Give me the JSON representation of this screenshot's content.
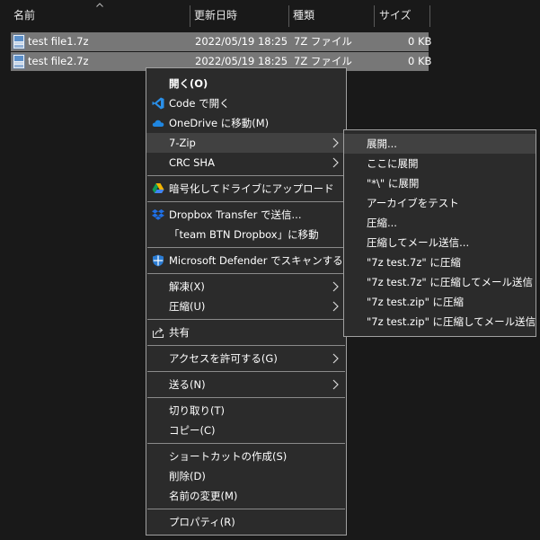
{
  "columns": {
    "name": "名前",
    "modified": "更新日時",
    "type": "種類",
    "size": "サイズ"
  },
  "files": [
    {
      "name": "test file1.7z",
      "modified": "2022/05/19 18:25",
      "type": "7Z ファイル",
      "size": "0 KB"
    },
    {
      "name": "test file2.7z",
      "modified": "2022/05/19 18:25",
      "type": "7Z ファイル",
      "size": "0 KB"
    }
  ],
  "context_menu": {
    "open": "開く(O)",
    "code": "Code で開く",
    "onedrive": "OneDrive に移動(M)",
    "zip7": "7-Zip",
    "crc": "CRC SHA",
    "encrypt": "暗号化してドライブにアップロード",
    "dropbox_transfer": "Dropbox Transfer で送信...",
    "dropbox_move": "「team BTN Dropbox」に移動",
    "defender": "Microsoft Defender でスキャンする...",
    "extract": "解凍(X)",
    "compress": "圧縮(U)",
    "share": "共有",
    "access": "アクセスを許可する(G)",
    "send": "送る(N)",
    "cut": "切り取り(T)",
    "copy": "コピー(C)",
    "shortcut": "ショートカットの作成(S)",
    "delete": "削除(D)",
    "rename": "名前の変更(M)",
    "properties": "プロパティ(R)"
  },
  "submenu_7zip": [
    "展開...",
    "ここに展開",
    "\"*\\\" に展開",
    "アーカイブをテスト",
    "圧縮...",
    "圧縮してメール送信...",
    "\"7z test.7z\" に圧縮",
    "\"7z test.7z\" に圧縮してメール送信",
    "\"7z test.zip\" に圧縮",
    "\"7z test.zip\" に圧縮してメール送信"
  ],
  "colors": {
    "background": "#191919",
    "selected_row": "#777777",
    "menu_bg": "#2b2b2b",
    "menu_highlight": "#414141",
    "vscode_blue": "#2a8fe8",
    "onedrive_blue": "#1f86e0",
    "dropbox_blue": "#1f6fe5",
    "defender_blue": "#2b7cd3"
  },
  "icons": [
    "sort-up-icon",
    "archive-file-icon",
    "vscode-icon",
    "onedrive-icon",
    "google-drive-icon",
    "dropbox-icon",
    "defender-shield-icon",
    "share-icon",
    "chevron-right-icon"
  ]
}
